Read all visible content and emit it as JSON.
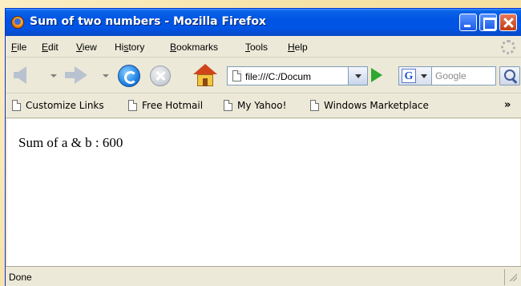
{
  "window": {
    "title": "Sum of two numbers - Mozilla Firefox"
  },
  "menu": {
    "items": [
      {
        "u": "F",
        "rest": "ile"
      },
      {
        "u": "E",
        "rest": "dit"
      },
      {
        "u": "V",
        "rest": "iew"
      },
      {
        "pre": "Hi",
        "u": "s",
        "rest": "tory"
      },
      {
        "u": "B",
        "rest": "ookmarks"
      },
      {
        "u": "T",
        "rest": "ools"
      },
      {
        "u": "H",
        "rest": "elp"
      }
    ]
  },
  "navigation": {
    "address": "file:///C:/Docum",
    "search_placeholder": "Google",
    "search_engine_letter": "G"
  },
  "bookmarks": {
    "items": [
      "Customize Links",
      "Free Hotmail",
      "My Yahoo!",
      "Windows Marketplace"
    ],
    "overflow": "»"
  },
  "content": {
    "text": "Sum of a & b : 600"
  },
  "status": {
    "text": "Done"
  },
  "colors": {
    "titlebar": "#0054e3",
    "chrome": "#ece9d8",
    "go_arrow": "#2ea82e"
  }
}
